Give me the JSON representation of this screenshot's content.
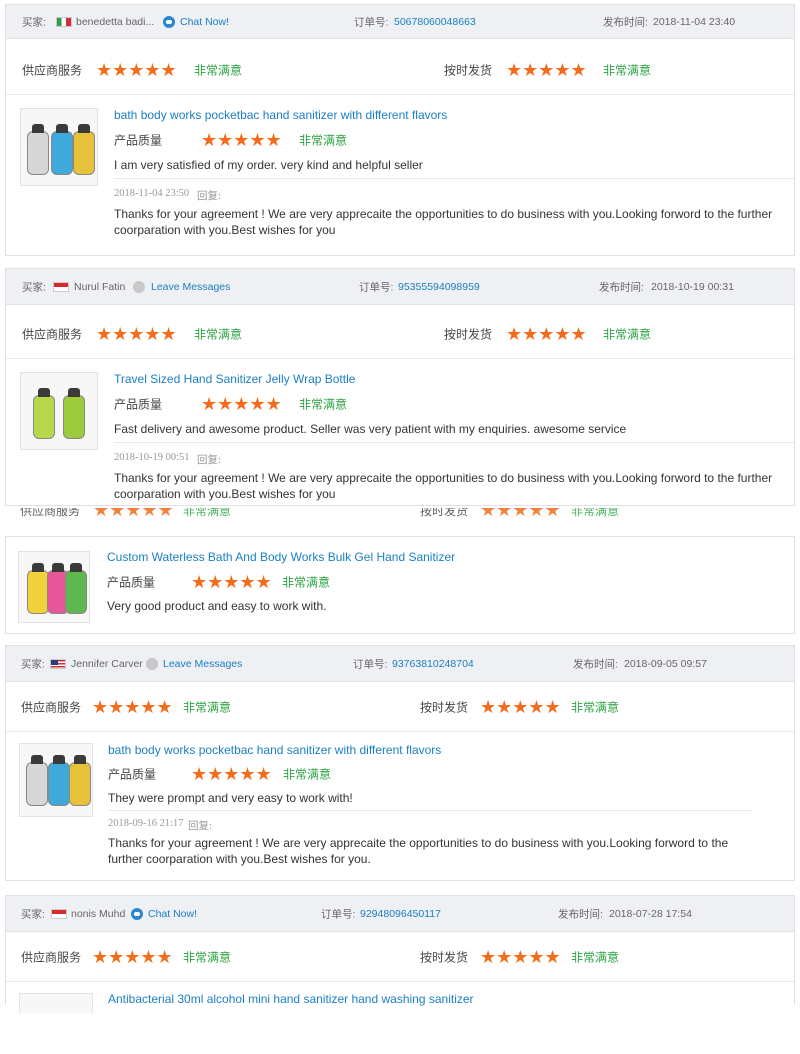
{
  "labels": {
    "buyer": "买家:",
    "order": "订单号:",
    "published": "发布时间:",
    "supplier_service": "供应商服务",
    "on_time": "按时发货",
    "quality": "产品质量",
    "satisfied": "非常满意",
    "reply": "回复:"
  },
  "stars": "★★★★★",
  "reply_text": "Thanks for your agreement ! We are very apprecaite the opportunities to do business with you.Looking forword to the further coorparation with you.Best wishes for you",
  "reply_text_dot": "Thanks for your agreement ! We are very apprecaite the opportunities to do business with you.Looking forword to the further coorparation with you.Best wishes for you.",
  "reviews": [
    {
      "buyer_name": "benedetta badi...",
      "action": "Chat Now!",
      "order_no": "50678060048663",
      "time": "2018-11-04 23:40",
      "product": "bath body works pocketbac hand sanitizer with different flavors",
      "comment": "I am very satisfied of my order. very kind and helpful seller",
      "comment_time": "2018-11-04 23:50"
    },
    {
      "buyer_name": "Nurul Fatin",
      "action": "Leave Messages",
      "order_no": "95355594098959",
      "time": "2018-10-19 00:31",
      "product": "Travel Sized Hand Sanitizer Jelly Wrap Bottle",
      "comment": "Fast delivery and awesome product. Seller was very patient with my enquiries. awesome service",
      "comment_time": "2018-10-19 00:51"
    },
    {
      "product": "Custom Waterless Bath And Body Works Bulk Gel Hand Sanitizer",
      "comment": "Very good product and easy to work with."
    },
    {
      "buyer_name": "Jennifer Carver",
      "action": "Leave Messages",
      "order_no": "93763810248704",
      "time": "2018-09-05 09:57",
      "product": "bath body works pocketbac hand sanitizer with different flavors",
      "comment": "They were prompt and very easy to work with!",
      "comment_time": "2018-09-16 21:17"
    },
    {
      "buyer_name": "nonis Muhd",
      "action": "Chat Now!",
      "order_no": "92948096450117",
      "time": "2018-07-28 17:54",
      "product": "Antibacterial 30ml alcohol mini hand sanitizer hand washing sanitizer"
    }
  ],
  "colors": {
    "star": "#f26d1b",
    "satisfied": "#2aa341",
    "link": "#1a7fc4",
    "header_bg": "#eef0f3"
  }
}
